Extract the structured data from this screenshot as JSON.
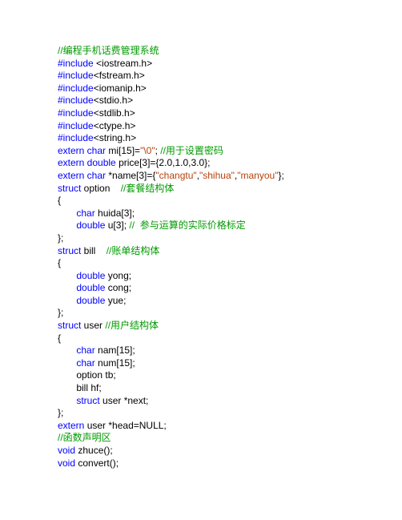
{
  "lines": [
    [
      [
        "cmt",
        "//编程手机话费管理系统"
      ]
    ],
    [
      [
        "kw",
        "#include "
      ],
      [
        "hdr",
        "<iostream.h>"
      ]
    ],
    [
      [
        "kw",
        "#include"
      ],
      [
        "hdr",
        "<fstream.h>"
      ]
    ],
    [
      [
        "kw",
        "#include"
      ],
      [
        "hdr",
        "<iomanip.h>"
      ]
    ],
    [
      [
        "kw",
        "#include"
      ],
      [
        "hdr",
        "<stdio.h>"
      ]
    ],
    [
      [
        "kw",
        "#include"
      ],
      [
        "hdr",
        "<stdlib.h>"
      ]
    ],
    [
      [
        "kw",
        "#include"
      ],
      [
        "hdr",
        "<ctype.h>"
      ]
    ],
    [
      [
        "kw",
        "#include"
      ],
      [
        "hdr",
        "<string.h>"
      ]
    ],
    [
      [
        "kw",
        "extern char"
      ],
      [
        "plain",
        " mi[15]="
      ],
      [
        "str",
        "\"\\0\""
      ],
      [
        "plain",
        "; "
      ],
      [
        "cmt",
        "//用于设置密码"
      ]
    ],
    [
      [
        "kw",
        "extern double"
      ],
      [
        "plain",
        " price[3]={2.0,1.0,3.0};"
      ]
    ],
    [
      [
        "kw",
        "extern char"
      ],
      [
        "plain",
        " *name[3]={"
      ],
      [
        "str",
        "\"changtu\""
      ],
      [
        "plain",
        ","
      ],
      [
        "str",
        "\"shihua\""
      ],
      [
        "plain",
        ","
      ],
      [
        "str",
        "\"manyou\""
      ],
      [
        "plain",
        "};"
      ]
    ],
    [
      [
        "kw",
        "struct"
      ],
      [
        "plain",
        " option    "
      ],
      [
        "cmt",
        "//套餐结构体"
      ]
    ],
    [
      [
        "plain",
        "{"
      ]
    ],
    [
      [
        "plain",
        "       "
      ],
      [
        "kw",
        "char"
      ],
      [
        "plain",
        " huida[3];"
      ]
    ],
    [
      [
        "plain",
        "       "
      ],
      [
        "kw",
        "double"
      ],
      [
        "plain",
        " u[3]; "
      ],
      [
        "cmt",
        "//  参与运算的实际价格标定"
      ]
    ],
    [
      [
        "plain",
        "};"
      ]
    ],
    [
      [
        "kw",
        "struct"
      ],
      [
        "plain",
        " bill    "
      ],
      [
        "cmt",
        "//账单结构体"
      ]
    ],
    [
      [
        "plain",
        "{"
      ]
    ],
    [
      [
        "plain",
        "       "
      ],
      [
        "kw",
        "double"
      ],
      [
        "plain",
        " yong;"
      ]
    ],
    [
      [
        "plain",
        "       "
      ],
      [
        "kw",
        "double"
      ],
      [
        "plain",
        " cong;"
      ]
    ],
    [
      [
        "plain",
        "       "
      ],
      [
        "kw",
        "double"
      ],
      [
        "plain",
        " yue;"
      ]
    ],
    [
      [
        "plain",
        "};"
      ]
    ],
    [
      [
        "kw",
        "struct"
      ],
      [
        "plain",
        " user "
      ],
      [
        "cmt",
        "//用户结构体"
      ]
    ],
    [
      [
        "plain",
        "{"
      ]
    ],
    [
      [
        "plain",
        "       "
      ],
      [
        "kw",
        "char"
      ],
      [
        "plain",
        " nam[15];"
      ]
    ],
    [
      [
        "plain",
        "       "
      ],
      [
        "kw",
        "char"
      ],
      [
        "plain",
        " num[15];"
      ]
    ],
    [
      [
        "plain",
        "       option tb;"
      ]
    ],
    [
      [
        "plain",
        "       bill hf;"
      ]
    ],
    [
      [
        "plain",
        "       "
      ],
      [
        "kw",
        "struct"
      ],
      [
        "plain",
        " user *next;"
      ]
    ],
    [
      [
        "plain",
        "};"
      ]
    ],
    [
      [
        "kw",
        "extern"
      ],
      [
        "plain",
        " user *head=NULL;"
      ]
    ],
    [
      [
        "cmt",
        "//函数声明区"
      ]
    ],
    [
      [
        "kw",
        "void"
      ],
      [
        "plain",
        " zhuce();"
      ]
    ],
    [
      [
        "kw",
        "void"
      ],
      [
        "plain",
        " convert();"
      ]
    ]
  ]
}
